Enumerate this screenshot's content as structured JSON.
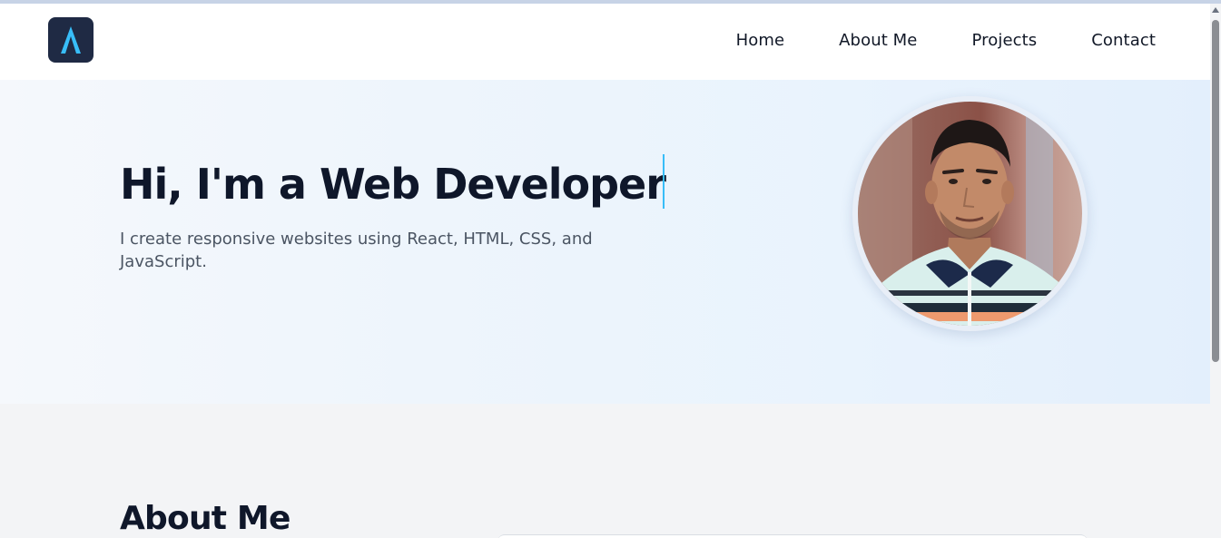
{
  "nav": {
    "logo_letter": "A",
    "links": [
      {
        "label": "Home"
      },
      {
        "label": "About Me"
      },
      {
        "label": "Projects"
      },
      {
        "label": "Contact"
      }
    ]
  },
  "hero": {
    "title": "Hi, I'm a Web Developer",
    "subtitle": "I create responsive websites using React, HTML, CSS, and JavaScript."
  },
  "about": {
    "title": "About Me"
  },
  "colors": {
    "logo_bg": "#1f2a44",
    "logo_accent": "#38bdf8",
    "heading": "#0f172a",
    "body_text": "#4b5563"
  }
}
